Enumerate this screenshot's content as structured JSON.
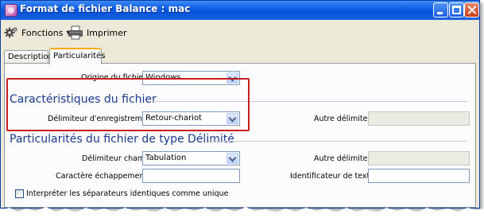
{
  "window": {
    "title": "Format de fichier Balance : mac",
    "controls": [
      "minimize-button",
      "maximize-button",
      "close-button"
    ]
  },
  "toolbar": {
    "functions_label": "Fonctions",
    "print_label": "Imprimer"
  },
  "tabs": [
    {
      "label": "Description",
      "active": false
    },
    {
      "label": "Particularités",
      "active": true
    }
  ],
  "form": {
    "origin": {
      "label": "Origine du fichier",
      "value": "Windows"
    },
    "section_characteristics": "Caractéristiques du fichier",
    "record_delimiter": {
      "label": "Délimiteur d'enregistrement",
      "value": "Retour-chariot"
    },
    "other_delimiter_1": {
      "label": "Autre délimiteur",
      "value": ""
    },
    "section_delimited": "Particularités du fichier de type Délimité",
    "field_delimiter": {
      "label": "Délimiteur champ",
      "value": "Tabulation"
    },
    "other_delimiter_2": {
      "label": "Autre délimiteur",
      "value": ""
    },
    "escape_char": {
      "label": "Caractère échappement",
      "value": ""
    },
    "text_identifier": {
      "label": "Identificateur de texte",
      "value": ""
    },
    "identical_separators": {
      "label": "Interpréter les séparateurs identiques comme unique",
      "checked": false
    }
  },
  "colors": {
    "titlebar": "#0a5be0",
    "section_heading": "#1a3a8c",
    "highlight_box": "#c81e1e",
    "active_tab_accent": "#f5a81c"
  }
}
